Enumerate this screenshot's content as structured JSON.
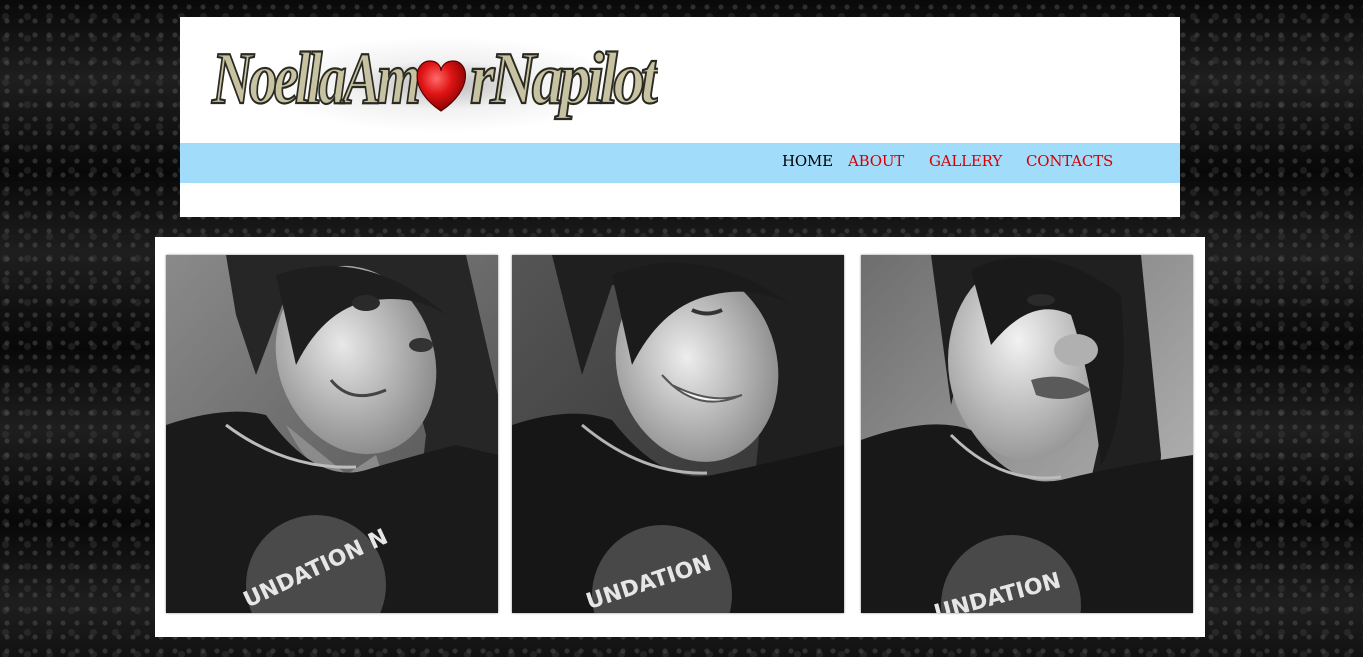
{
  "site": {
    "logo_text": "NoellaAmorNapilot",
    "logo_parts": {
      "first": "NoellaAm",
      "second": "rNapilot"
    }
  },
  "nav": {
    "items": [
      {
        "label": "HOME",
        "active": true
      },
      {
        "label": "ABOUT",
        "active": false
      },
      {
        "label": "GALLERY",
        "active": false
      },
      {
        "label": "CONTACTS",
        "active": false
      }
    ]
  },
  "gallery": {
    "photos": [
      {
        "shirt_text": "UNDATION N"
      },
      {
        "shirt_text": "UNDATION"
      },
      {
        "shirt_text": "UNDATION"
      }
    ]
  },
  "colors": {
    "nav_bar": "#a2dcfb",
    "nav_link": "#d60000",
    "nav_active": "#000000",
    "logo_text_fill": "#c7c3a2",
    "logo_heart": "#d11010"
  }
}
